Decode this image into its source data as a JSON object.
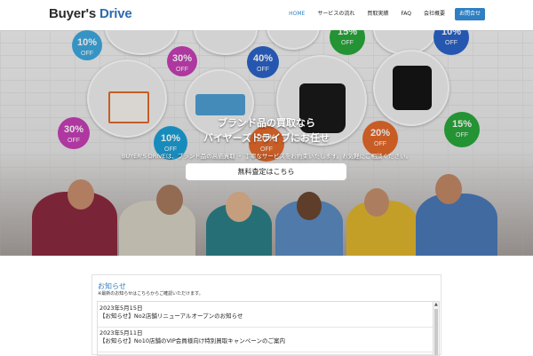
{
  "logo": {
    "part1": "Buyer's",
    "part2": "Drive"
  },
  "nav": {
    "items": [
      "HOME",
      "サービスの流れ",
      "買取実績",
      "FAQ",
      "会社概要"
    ],
    "cta": "お問合せ"
  },
  "hero": {
    "title_line1": "ブランド品の買取なら",
    "title_line2": "バイヤーズドライブにお任せ",
    "subtitle": "BUYER'S DRIVEは、ブランド品の高価買取 ・ 丁寧なサービスをお約束いたします。お気軽にご相談ください。",
    "button_label": "無料査定はこちら",
    "badges": [
      {
        "value": "10%",
        "unit": "OFF",
        "color": "#3ea9e0"
      },
      {
        "value": "30%",
        "unit": "OFF",
        "color": "#c73fb7"
      },
      {
        "value": "40%",
        "unit": "OFF",
        "color": "#2b63c9"
      },
      {
        "value": "10%",
        "unit": "OFF",
        "color": "#2b63c9"
      },
      {
        "value": "15%",
        "unit": "OFF",
        "color": "#28a83b"
      },
      {
        "value": "30%",
        "unit": "OFF",
        "color": "#c73fb7"
      },
      {
        "value": "10%",
        "unit": "OFF",
        "color": "#1ba0d6"
      },
      {
        "value": "20%",
        "unit": "OFF",
        "color": "#e4692b"
      },
      {
        "value": "15%",
        "unit": "OFF",
        "color": "#28a83b"
      },
      {
        "value": "20%",
        "unit": "OFF",
        "color": "#e4692b"
      }
    ]
  },
  "news": {
    "title": "お知らせ",
    "note": "※最新のお知らせはこちらからご確認いただけます。",
    "items": [
      {
        "date": "2023年5月15日",
        "text": "【お知らせ】No2店舗リニューアルオープンのお知らせ"
      },
      {
        "date": "2023年5月11日",
        "text": "【お知らせ】No10店舗のVIP会員様向け特別買取キャンペーンのご案内"
      }
    ]
  },
  "colors": {
    "accent": "#2f7fc2",
    "logo_dark": "#2b2b2b"
  }
}
